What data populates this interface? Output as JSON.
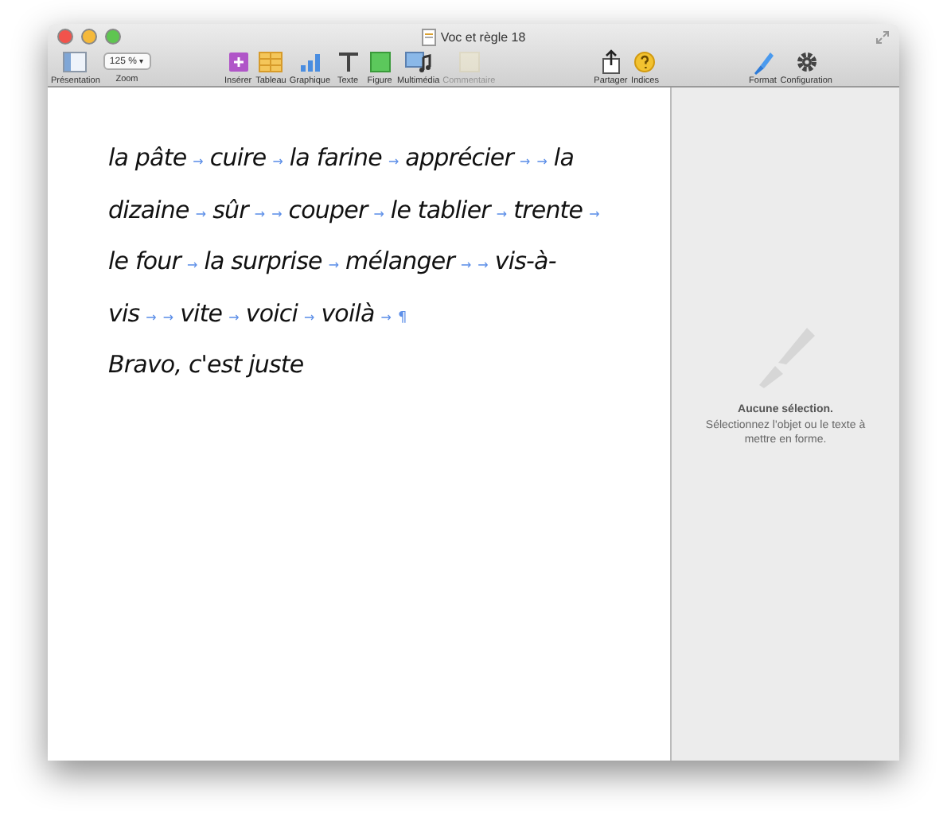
{
  "window": {
    "title": "Voc et règle 18"
  },
  "toolbar": {
    "groups": [
      [
        {
          "kind": "view",
          "label": "Présentation",
          "disabled": false
        },
        {
          "kind": "zoom",
          "label": "Zoom",
          "value": "125 %",
          "caret": "▾",
          "disabled": false
        }
      ],
      [
        {
          "kind": "insert",
          "label": "Insérer",
          "disabled": false
        },
        {
          "kind": "table",
          "label": "Tableau",
          "disabled": false
        },
        {
          "kind": "chart",
          "label": "Graphique",
          "disabled": false
        },
        {
          "kind": "text",
          "label": "Texte",
          "disabled": false
        },
        {
          "kind": "shape",
          "label": "Figure",
          "disabled": false
        },
        {
          "kind": "media",
          "label": "Multimédia",
          "disabled": false
        },
        {
          "kind": "comment",
          "label": "Commentaire",
          "disabled": true
        }
      ],
      [
        {
          "kind": "share",
          "label": "Partager",
          "disabled": false
        },
        {
          "kind": "tips",
          "label": "Indices",
          "disabled": false
        }
      ],
      [
        {
          "kind": "format",
          "label": "Format",
          "disabled": false
        },
        {
          "kind": "setup",
          "label": "Configuration",
          "disabled": false
        }
      ]
    ]
  },
  "document": {
    "lines": [
      [
        {
          "kind": "word",
          "text": "la pâte"
        },
        {
          "kind": "tab",
          "text": "→"
        },
        {
          "kind": "word",
          "text": "cuire"
        },
        {
          "kind": "tab",
          "text": "→"
        },
        {
          "kind": "word",
          "text": "la farine"
        },
        {
          "kind": "tab",
          "text": "→"
        },
        {
          "kind": "word",
          "text": "apprécier"
        },
        {
          "kind": "tab",
          "text": "→"
        },
        {
          "kind": "tab",
          "text": "→"
        },
        {
          "kind": "word",
          "text": "la"
        }
      ],
      [
        {
          "kind": "word",
          "text": "dizaine"
        },
        {
          "kind": "tab",
          "text": "→"
        },
        {
          "kind": "word",
          "text": "sûr"
        },
        {
          "kind": "tab",
          "text": "→"
        },
        {
          "kind": "tab",
          "text": "→"
        },
        {
          "kind": "word",
          "text": "couper"
        },
        {
          "kind": "tab",
          "text": "→"
        },
        {
          "kind": "word",
          "text": "le tablier"
        },
        {
          "kind": "tab",
          "text": "→"
        },
        {
          "kind": "word",
          "text": "trente"
        },
        {
          "kind": "tab",
          "text": "→"
        }
      ],
      [
        {
          "kind": "word",
          "text": "le four"
        },
        {
          "kind": "tab",
          "text": "→"
        },
        {
          "kind": "word",
          "text": "la surprise"
        },
        {
          "kind": "tab",
          "text": "→"
        },
        {
          "kind": "word",
          "text": "mélanger"
        },
        {
          "kind": "tab",
          "text": "→"
        },
        {
          "kind": "tab",
          "text": "→"
        },
        {
          "kind": "word",
          "text": "vis-à-"
        }
      ],
      [
        {
          "kind": "word",
          "text": "vis"
        },
        {
          "kind": "tab",
          "text": "→"
        },
        {
          "kind": "tab",
          "text": "→"
        },
        {
          "kind": "word",
          "text": "vite"
        },
        {
          "kind": "tab",
          "text": "→"
        },
        {
          "kind": "word",
          "text": "voici"
        },
        {
          "kind": "tab",
          "text": "→"
        },
        {
          "kind": "word",
          "text": "voilà"
        },
        {
          "kind": "tab",
          "text": "→"
        },
        {
          "kind": "mark",
          "text": "¶"
        }
      ],
      [
        {
          "kind": "word",
          "text": "Bravo, c'est juste"
        }
      ]
    ]
  },
  "inspector": {
    "title": "Aucune sélection.",
    "hint": "Sélectionnez l'objet ou le texte à mettre en forme."
  }
}
